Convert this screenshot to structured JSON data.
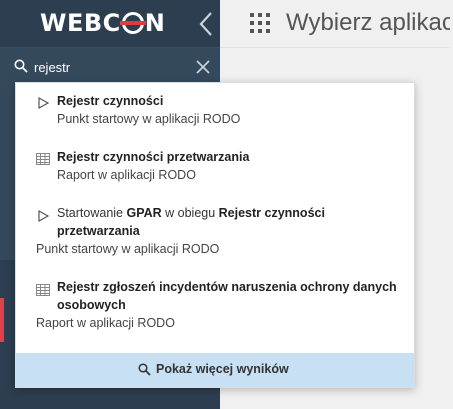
{
  "brand": {
    "logo_text_left": "WEBC",
    "logo_text_right": "N",
    "accent_color": "#e03a3a"
  },
  "topbar": {
    "app_picker_label": "Wybierz aplikację"
  },
  "search": {
    "value": "rejestr"
  },
  "results": [
    {
      "type": "start-point",
      "title": "Rejestr czynności",
      "subtitle": "Punkt startowy w aplikacji RODO"
    },
    {
      "type": "report",
      "title": "Rejestr czynności przetwarzania",
      "subtitle": "Raport w aplikacji RODO"
    },
    {
      "type": "start-point",
      "title_prefix": "Startowanie ",
      "title_bold_1": "GPAR",
      "title_middle": " w obiegu ",
      "title_bold_2": "Rejestr czynności",
      "title_line2": "przetwarzania",
      "subtitle": "Punkt startowy w aplikacji RODO"
    },
    {
      "type": "report",
      "title_line1": "Rejestr zgłoszeń incydentów naruszenia ochrony danych",
      "title_line2": "osobowych",
      "subtitle": "Raport w aplikacji RODO"
    }
  ],
  "more_results_label": "Pokaż więcej wyników"
}
